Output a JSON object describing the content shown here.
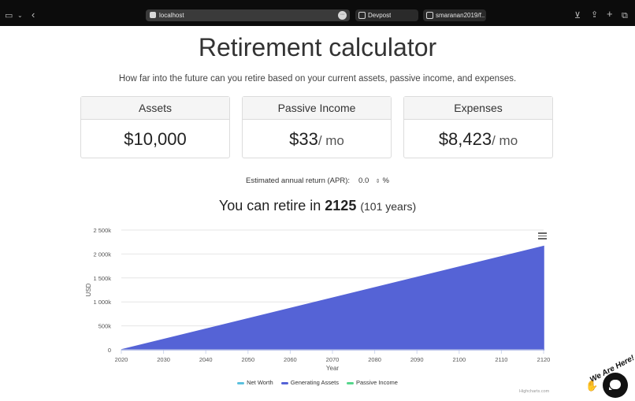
{
  "browser": {
    "url": "localhost",
    "tabs": [
      "Devpost",
      "smaranan2019/f..."
    ]
  },
  "page": {
    "title": "Retirement calculator",
    "subtitle": "How far into the future can you retire based on your current assets, passive income, and expenses."
  },
  "cards": {
    "assets": {
      "label": "Assets",
      "value": "$10,000",
      "unit": ""
    },
    "passive": {
      "label": "Passive Income",
      "value": "$33",
      "unit": "/ mo"
    },
    "expenses": {
      "label": "Expenses",
      "value": "$8,423",
      "unit": "/ mo"
    }
  },
  "apr": {
    "label": "Estimated annual return (APR):",
    "value": "0.0",
    "suffix": "%"
  },
  "result": {
    "prefix": "You can retire in",
    "year": "2125",
    "years": "(101 years)"
  },
  "chart_data": {
    "type": "area",
    "xlabel": "Year",
    "ylabel": "USD",
    "xlim": [
      2020,
      2120
    ],
    "ylim": [
      0,
      2500000
    ],
    "x_ticks": [
      "2020",
      "2030",
      "2040",
      "2050",
      "2060",
      "2070",
      "2080",
      "2090",
      "2100",
      "2110",
      "2120"
    ],
    "y_ticks": [
      "0",
      "500k",
      "1 000k",
      "1 500k",
      "2 000k",
      "2 500k"
    ],
    "y_tick_values": [
      0,
      500000,
      1000000,
      1500000,
      2000000,
      2500000
    ],
    "grid": true,
    "legend_position": "bottom",
    "series": [
      {
        "name": "Net Worth",
        "color": "#5bc0de",
        "x": [],
        "values": []
      },
      {
        "name": "Generating Assets",
        "color": "#5563d6",
        "x": [
          2020,
          2120
        ],
        "values": [
          0,
          2160000
        ]
      },
      {
        "name": "Passive Income",
        "color": "#55d68b",
        "x": [],
        "values": []
      }
    ],
    "credits": "Highcharts.com"
  },
  "widget": {
    "label": "We Are Here!"
  }
}
